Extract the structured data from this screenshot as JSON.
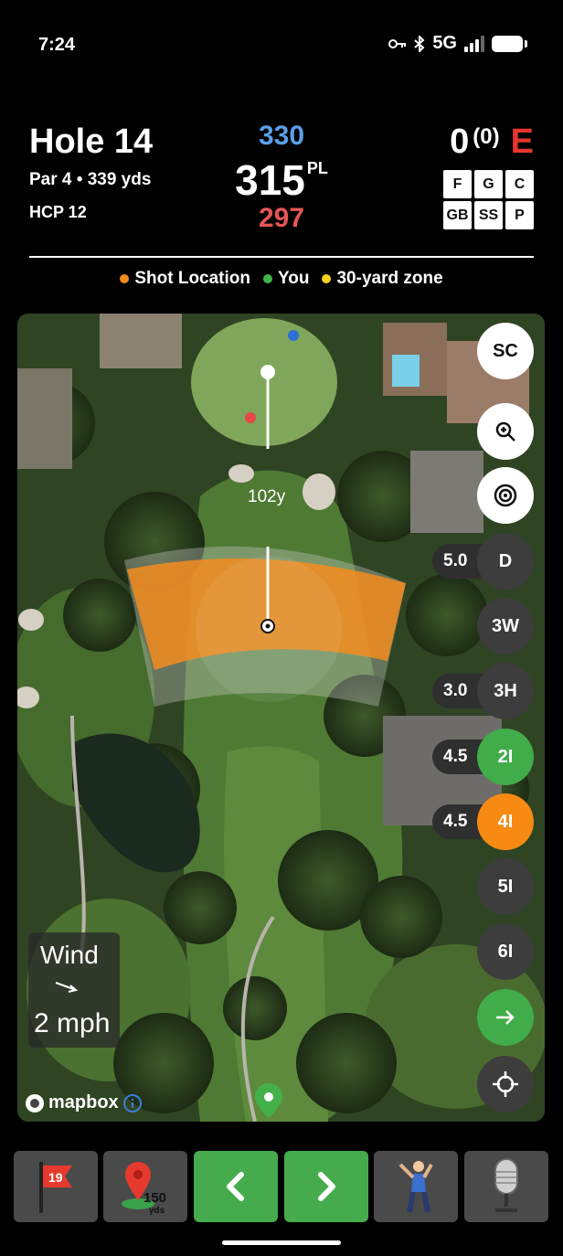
{
  "status": {
    "time": "7:24",
    "network": "5G"
  },
  "hole": {
    "title": "Hole 14",
    "subtitle": "Par 4  •  339 yds",
    "hcp": "HCP 12"
  },
  "distances": {
    "back": "330",
    "middle": "315",
    "middle_suffix": "PL",
    "front": "297"
  },
  "score": {
    "strokes": "0",
    "putts": "(0)",
    "relative": "E"
  },
  "stat_buttons": [
    "F",
    "G",
    "C",
    "GB",
    "SS",
    "P"
  ],
  "legend": [
    {
      "label": "Shot Location",
      "color": "#f58a1f"
    },
    {
      "label": "You",
      "color": "#3db54a"
    },
    {
      "label": "30-yard zone",
      "color": "#f5d021"
    }
  ],
  "map": {
    "distance_to_green": "102y",
    "attribution": "mapbox",
    "wind": {
      "label": "Wind",
      "speed": "2 mph"
    },
    "controls": {
      "sc": "SC"
    },
    "clubs": [
      {
        "name": "D",
        "distance": "5.0"
      },
      {
        "name": "3W",
        "distance": ""
      },
      {
        "name": "3H",
        "distance": "3.0"
      },
      {
        "name": "2I",
        "distance": "4.5"
      },
      {
        "name": "4I",
        "distance": "4.5"
      },
      {
        "name": "5I",
        "distance": ""
      },
      {
        "name": "6I",
        "distance": ""
      }
    ]
  },
  "bottom_bar": {
    "flag_number": "19",
    "marker_distance": "150",
    "marker_unit": "yds"
  }
}
